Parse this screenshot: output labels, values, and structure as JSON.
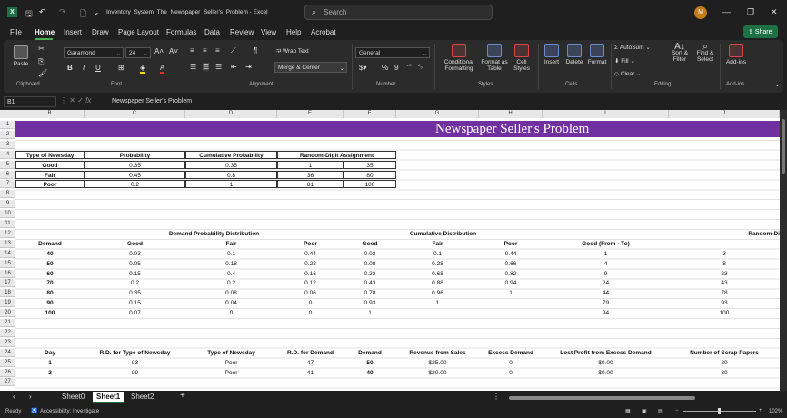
{
  "window": {
    "filename": "Inventory_System_The_Newspaper_Seller's_Problem - Excel",
    "search_placeholder": "Search",
    "avatar_initial": "M"
  },
  "menu": [
    "File",
    "Home",
    "Insert",
    "Draw",
    "Page Layout",
    "Formulas",
    "Data",
    "Review",
    "View",
    "Help",
    "Acrobat"
  ],
  "share_label": "Share",
  "ribbon": {
    "paste": "Paste",
    "font_name": "Garamond",
    "font_size": "24",
    "wrap_text": "Wrap Text",
    "merge_center": "Merge & Center",
    "number_format": "General",
    "conditional_formatting": "Conditional Formatting",
    "format_as_table": "Format as Table",
    "cell_styles": "Cell Styles",
    "insert": "Insert",
    "delete": "Delete",
    "format": "Format",
    "autosum": "AutoSum",
    "fill": "Fill",
    "clear": "Clear",
    "sort_filter": "Sort & Filter",
    "find_select": "Find & Select",
    "addins": "Add-ins",
    "groups": [
      "Clipboard",
      "Font",
      "Alignment",
      "Number",
      "Styles",
      "Cells",
      "Editing",
      "Add-ins"
    ]
  },
  "formula_bar": {
    "name_box": "B1",
    "fx": "fx",
    "content": "Newspaper Seller's Problem"
  },
  "columns": [
    "B",
    "C",
    "D",
    "E",
    "F",
    "G",
    "H",
    "I",
    "J"
  ],
  "rows": [
    "1",
    "2",
    "3",
    "4",
    "5",
    "6",
    "7",
    "8",
    "9",
    "10",
    "11",
    "12",
    "13",
    "14",
    "15",
    "16",
    "17",
    "18",
    "19",
    "20",
    "21",
    "22",
    "23",
    "24",
    "25",
    "26",
    "27"
  ],
  "sheet": {
    "banner": "Newspaper Seller's Problem",
    "t1_headers": [
      "Type of Newsday",
      "Probability",
      "Cumulative Probability",
      "Random-Digit Assignment"
    ],
    "t1_rows": [
      [
        "Good",
        "0.35",
        "0.35",
        "1",
        "35"
      ],
      [
        "Fair",
        "0.45",
        "0.8",
        "36",
        "80"
      ],
      [
        "Poor",
        "0.2",
        "1",
        "81",
        "100"
      ]
    ],
    "t2_group_headers": [
      "Demand Probability Distribution",
      "Cumulative Distribution",
      "Random-Di"
    ],
    "t2_headers": [
      "Demand",
      "Good",
      "Fair",
      "Poor",
      "Good",
      "Fair",
      "Poor",
      "Good (From - To)"
    ],
    "t2_rows": [
      [
        "40",
        "0.03",
        "0.1",
        "0.44",
        "0.03",
        "0.1",
        "0.44",
        "1",
        "3"
      ],
      [
        "50",
        "0.05",
        "0.18",
        "0.22",
        "0.08",
        "0.28",
        "0.66",
        "4",
        "8"
      ],
      [
        "60",
        "0.15",
        "0.4",
        "0.16",
        "0.23",
        "0.68",
        "0.82",
        "9",
        "23"
      ],
      [
        "70",
        "0.2",
        "0.2",
        "0.12",
        "0.43",
        "0.88",
        "0.94",
        "24",
        "43"
      ],
      [
        "80",
        "0.35",
        "0.08",
        "0.06",
        "0.78",
        "0.96",
        "1",
        "44",
        "78"
      ],
      [
        "90",
        "0.15",
        "0.04",
        "0",
        "0.93",
        "1",
        "",
        "79",
        "93"
      ],
      [
        "100",
        "0.07",
        "0",
        "0",
        "1",
        "",
        "",
        "94",
        "100"
      ]
    ],
    "t3_headers": [
      "Day",
      "R.D. for Type of Newsday",
      "Type of Newsday",
      "R.D. for Demand",
      "Demand",
      "Revenue from Sales",
      "Excess Demand",
      "Lost Profit from Excess Demand",
      "Number of Scrap Papers"
    ],
    "t3_rows": [
      [
        "1",
        "93",
        "Poor",
        "47",
        "50",
        "$25.00",
        "0",
        "$0.00",
        "20"
      ],
      [
        "2",
        "99",
        "Poor",
        "41",
        "40",
        "$20.00",
        "0",
        "$0.00",
        "30"
      ]
    ]
  },
  "tabs": [
    "Sheet0",
    "Sheet1",
    "Sheet2"
  ],
  "status": {
    "ready": "Ready",
    "accessibility": "Accessibility: Investigate",
    "zoom": "102%"
  }
}
